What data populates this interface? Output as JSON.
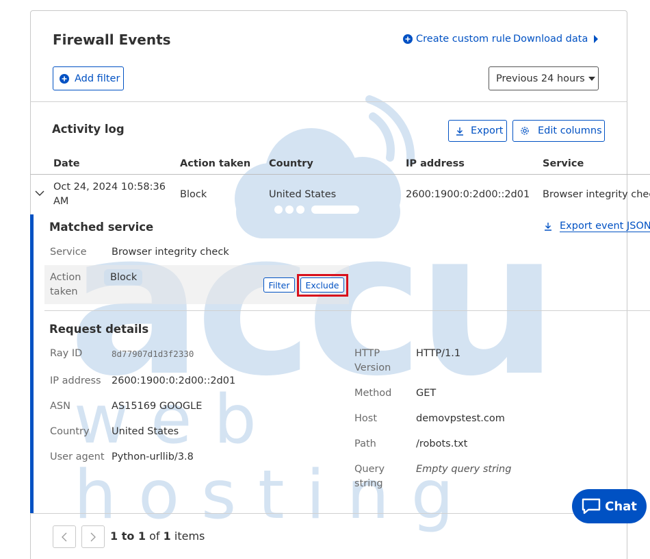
{
  "header": {
    "title": "Firewall Events",
    "create_rule": "Create custom rule",
    "download": "Download data",
    "add_filter": "Add filter",
    "time_range": "Previous 24 hours"
  },
  "activity": {
    "title": "Activity log",
    "export": "Export",
    "edit_columns": "Edit columns",
    "columns": [
      "Date",
      "Action taken",
      "Country",
      "IP address",
      "Service"
    ],
    "row": {
      "date_line1": "Oct 24, 2024 10:58:36",
      "date_line2": "AM",
      "action": "Block",
      "country": "United States",
      "ip": "2600:1900:0:2d00::2d01",
      "service": "Browser integrity check"
    }
  },
  "matched": {
    "title": "Matched service",
    "export_json": "Export event JSON",
    "service_label": "Service",
    "service_value": "Browser integrity check",
    "action_label_1": "Action",
    "action_label_2": "taken",
    "action_value": "Block",
    "filter_btn": "Filter",
    "exclude_btn": "Exclude"
  },
  "request": {
    "title": "Request details",
    "left": [
      {
        "label": "Ray ID",
        "value": "8d77907d1d3f2330"
      },
      {
        "label": "IP address",
        "value": "2600:1900:0:2d00::2d01"
      },
      {
        "label": "ASN",
        "value": "AS15169 GOOGLE"
      },
      {
        "label": "Country",
        "value": "United States"
      },
      {
        "label": "User agent",
        "value": "Python-urllib/3.8"
      }
    ],
    "right": {
      "http_label_1": "HTTP",
      "http_label_2": "Version",
      "http_value": "HTTP/1.1",
      "method_label": "Method",
      "method_value": "GET",
      "host_label": "Host",
      "host_value": "demovpstest.com",
      "path_label": "Path",
      "path_value": "/robots.txt",
      "query_label_1": "Query",
      "query_label_2": "string",
      "query_value": "Empty query string"
    }
  },
  "pager": {
    "range": "1 to 1",
    "of": "of",
    "total": "1",
    "items": "items"
  },
  "chat": {
    "label": "Chat"
  },
  "watermark": {
    "word": "accu",
    "sub": "web hosting"
  },
  "colors": {
    "accent": "#0051c3",
    "highlight": "#d8101c",
    "watermark": "#c4d9ee"
  }
}
